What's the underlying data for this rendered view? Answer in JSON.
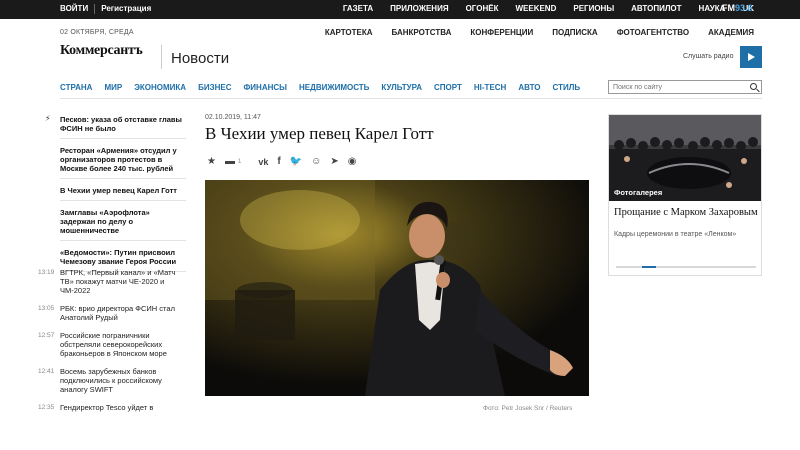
{
  "topbar": {
    "login": "ВОЙТИ",
    "register": "Регистрация",
    "nav": [
      "ГАЗЕТА",
      "ПРИЛОЖЕНИЯ",
      "ОГОНЁК",
      "WEEKEND",
      "РЕГИОНЫ",
      "АВТОПИЛОТ",
      "НАУКА",
      "UK"
    ],
    "fm_label": "FM",
    "fm_freq": "93.6"
  },
  "header": {
    "date": "02 ОКТЯБРЯ, СРЕДА",
    "logo": "Коммерсантъ",
    "section": "Новости",
    "subnav": [
      "КАРТОТЕКА",
      "БАНКРОТСТВА",
      "КОНФЕРЕНЦИИ",
      "ПОДПИСКА",
      "ФОТОАГЕНТСТВО",
      "АКАДЕМИЯ"
    ],
    "radio_label": "Слушать радио"
  },
  "rubrics": [
    "СТРАНА",
    "МИР",
    "ЭКОНОМИКА",
    "БИЗНЕС",
    "ФИНАНСЫ",
    "НЕДВИЖИМОСТЬ",
    "КУЛЬТУРА",
    "СПОРТ",
    "HI-TECH",
    "АВТО",
    "СТИЛЬ"
  ],
  "search": {
    "placeholder": "Поиск по сайту"
  },
  "top_news": [
    "Песков: указа об отставке главы ФСИН не было",
    "Ресторан «Армения» отсудил у организаторов протестов в Москве более 240 тыс. рублей",
    "В Чехии умер певец Карел Готт",
    "Замглавы «Аэрофлота» задержан по делу о мошенничестве",
    "«Ведомости»: Путин присвоил Чемезову звание Героя России"
  ],
  "feed": [
    {
      "time": "13:19",
      "text": "ВГТРК, «Первый канал» и «Матч ТВ» покажут матчи ЧЕ-2020 и ЧМ-2022"
    },
    {
      "time": "13:05",
      "text": "РБК: врио директора ФСИН стал Анатолий Рудый"
    },
    {
      "time": "12:57",
      "text": "Российские пограничники обстреляли северокорейских браконьеров в Японском море"
    },
    {
      "time": "12:41",
      "text": "Восемь зарубежных банков подключились к российскому аналогу SWIFT"
    },
    {
      "time": "12:35",
      "text": "Гендиректор Tesco уйдет в"
    }
  ],
  "article": {
    "datetime": "02.10.2019, 11:47",
    "title": "В Чехии умер певец Карел Готт",
    "comment_count": "1",
    "photo_credit": "Фото: Petr Josek Snr / Reuters"
  },
  "gallery": {
    "tag": "Фотогалерея",
    "title": "Прощание с Марком Захаровым",
    "subtitle": "Кадры церемонии в театре «Ленком»"
  }
}
